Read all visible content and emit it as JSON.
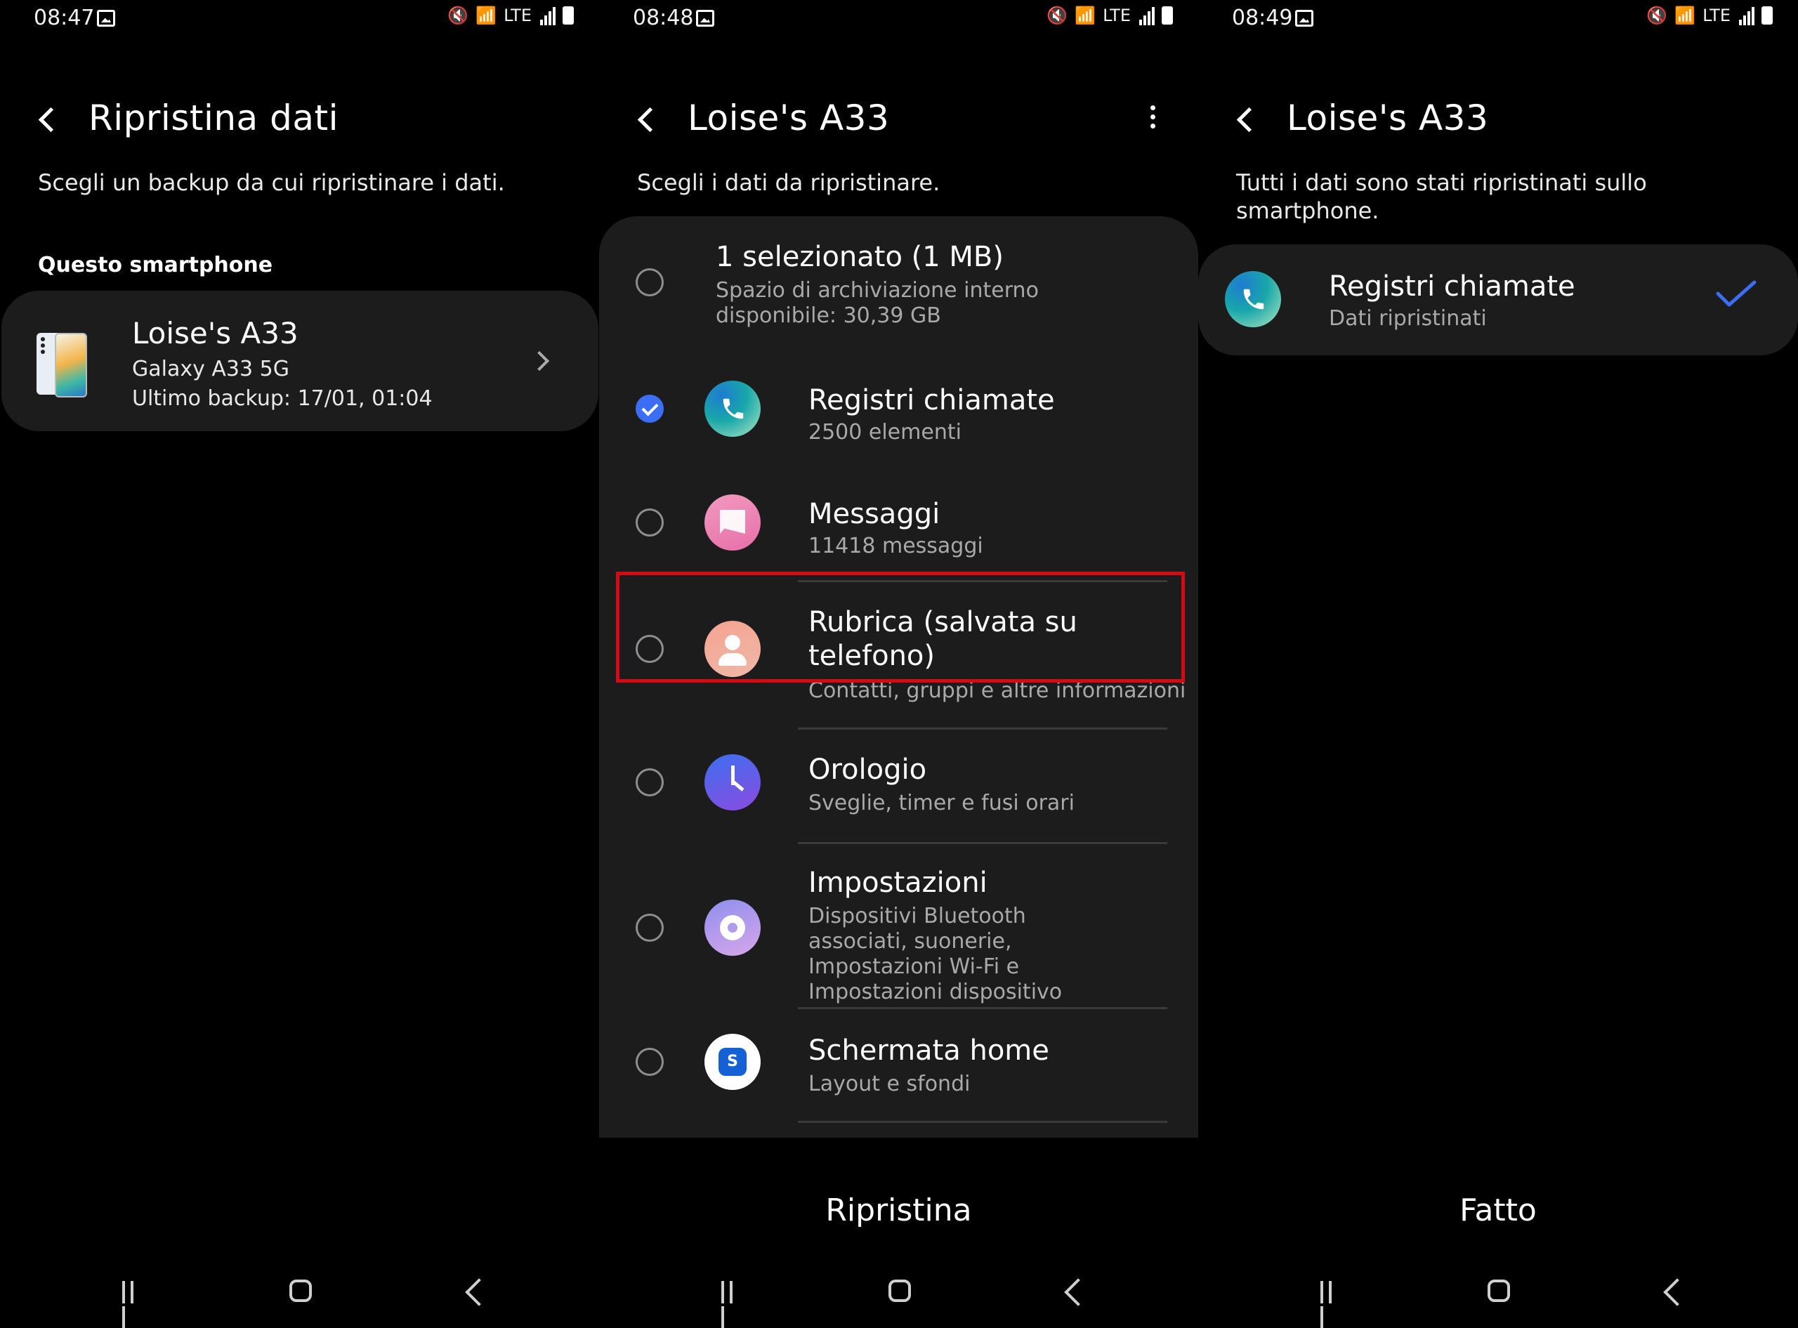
{
  "panel1": {
    "status": {
      "time": "08:47",
      "network": "LTE"
    },
    "title": "Ripristina dati",
    "subtitle": "Scegli un backup da cui ripristinare i dati.",
    "section_label": "Questo smartphone",
    "backup": {
      "name": "Loise's A33",
      "model": "Galaxy A33 5G",
      "last_backup": "Ultimo backup: 17/01, 01:04"
    }
  },
  "panel2": {
    "status": {
      "time": "08:48",
      "network": "LTE"
    },
    "title": "Loise's A33",
    "subtitle": "Scegli i dati da ripristinare.",
    "summary": {
      "title": "1 selezionato (1 MB)",
      "subtitle": "Spazio di archiviazione interno disponibile: 30,39 GB"
    },
    "items": [
      {
        "title": "Registri chiamate",
        "subtitle": "2500 elementi",
        "checked": true,
        "icon": "phone-icon"
      },
      {
        "title": "Messaggi",
        "subtitle": "11418 messaggi",
        "checked": false,
        "icon": "message-icon"
      },
      {
        "title": "Rubrica (salvata su telefono)",
        "subtitle": "Contatti, gruppi e altre informazioni",
        "checked": false,
        "icon": "contacts-icon"
      },
      {
        "title": "Orologio",
        "subtitle": "Sveglie, timer e fusi orari",
        "checked": false,
        "icon": "clock-icon"
      },
      {
        "title": "Impostazioni",
        "subtitle": "Dispositivi Bluetooth associati, suonerie, Impostazioni Wi-Fi e Impostazioni dispositivo",
        "checked": false,
        "icon": "settings-gear-icon"
      },
      {
        "title": "Schermata home",
        "subtitle": "Layout e sfondi",
        "checked": false,
        "icon": "home-screen-icon"
      }
    ],
    "home_glyph": "S",
    "action": "Ripristina"
  },
  "panel3": {
    "status": {
      "time": "08:49",
      "network": "LTE"
    },
    "title": "Loise's A33",
    "subtitle": "Tutti i dati sono stati ripristinati sullo smartphone.",
    "item": {
      "title": "Registri chiamate",
      "subtitle": "Dati ripristinati"
    },
    "action": "Fatto"
  },
  "colors": {
    "accent": "#3b6ef5",
    "highlight": "#d60a14",
    "card": "#1c1c1c",
    "divider": "#3a3a3a"
  }
}
